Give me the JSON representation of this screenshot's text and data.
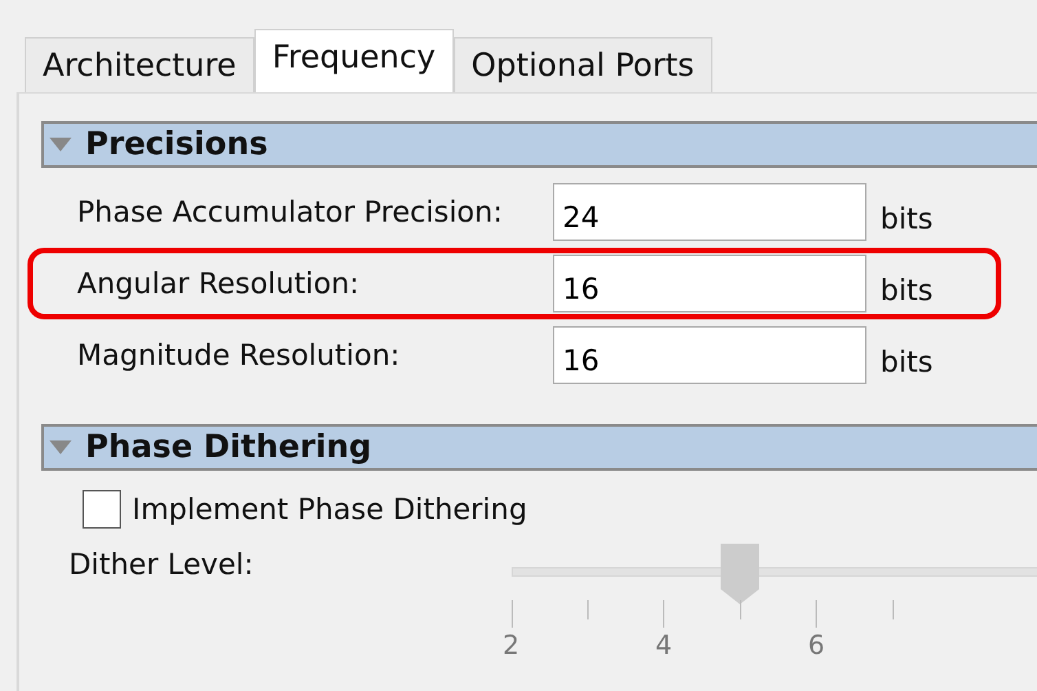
{
  "tabs": [
    {
      "label": "Architecture",
      "selected": false
    },
    {
      "label": "Frequency",
      "selected": true
    },
    {
      "label": "Optional Ports",
      "selected": false
    }
  ],
  "sections": [
    {
      "title": "Precisions",
      "expanded": true,
      "fields": [
        {
          "kind": "number",
          "label": "Phase Accumulator Precision:",
          "value": "24",
          "unit": "bits",
          "highlighted": false
        },
        {
          "kind": "number",
          "label": "Angular Resolution:",
          "value": "16",
          "unit": "bits",
          "highlighted": true
        },
        {
          "kind": "number",
          "label": "Magnitude Resolution:",
          "value": "16",
          "unit": "bits",
          "highlighted": false
        }
      ]
    },
    {
      "title": "Phase Dithering",
      "expanded": true,
      "fields": [
        {
          "kind": "checkbox",
          "label": "Implement Phase Dithering",
          "checked": false
        },
        {
          "kind": "slider",
          "label": "Dither Level:",
          "disabled": true,
          "level": 0.375,
          "tick_labels": [
            "2",
            "4",
            "6"
          ]
        }
      ]
    }
  ]
}
